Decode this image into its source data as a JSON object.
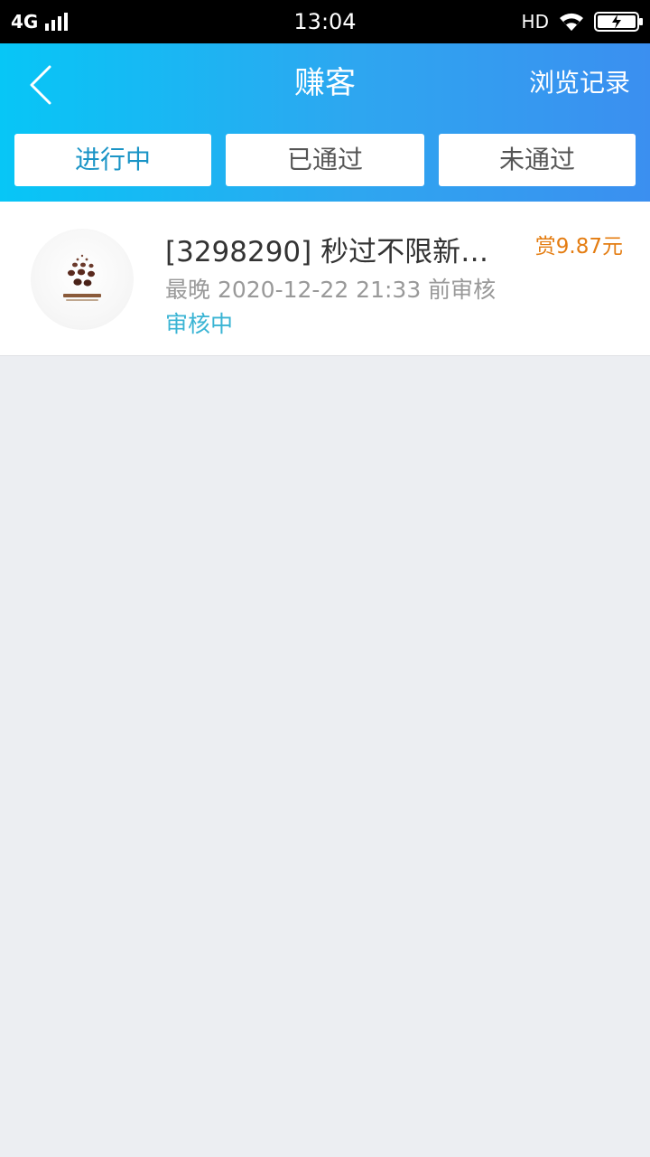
{
  "status_bar": {
    "network": "4G",
    "time": "13:04",
    "hd": "HD"
  },
  "header": {
    "title": "赚客",
    "history_label": "浏览记录"
  },
  "tabs": [
    {
      "label": "进行中",
      "active": true
    },
    {
      "label": "已通过",
      "active": false
    },
    {
      "label": "未通过",
      "active": false
    }
  ],
  "tasks": [
    {
      "title": "[3298290] 秒过不限新老…",
      "deadline": "最晚 2020-12-22 21:33 前审核",
      "status": "审核中",
      "reward": "赏9.87元"
    }
  ],
  "colors": {
    "header_start": "#07c6f6",
    "header_end": "#3b8ff0",
    "active_tab": "#1a94c6",
    "reward": "#e47d12",
    "status": "#3ab4d4",
    "background": "#eceef2"
  }
}
